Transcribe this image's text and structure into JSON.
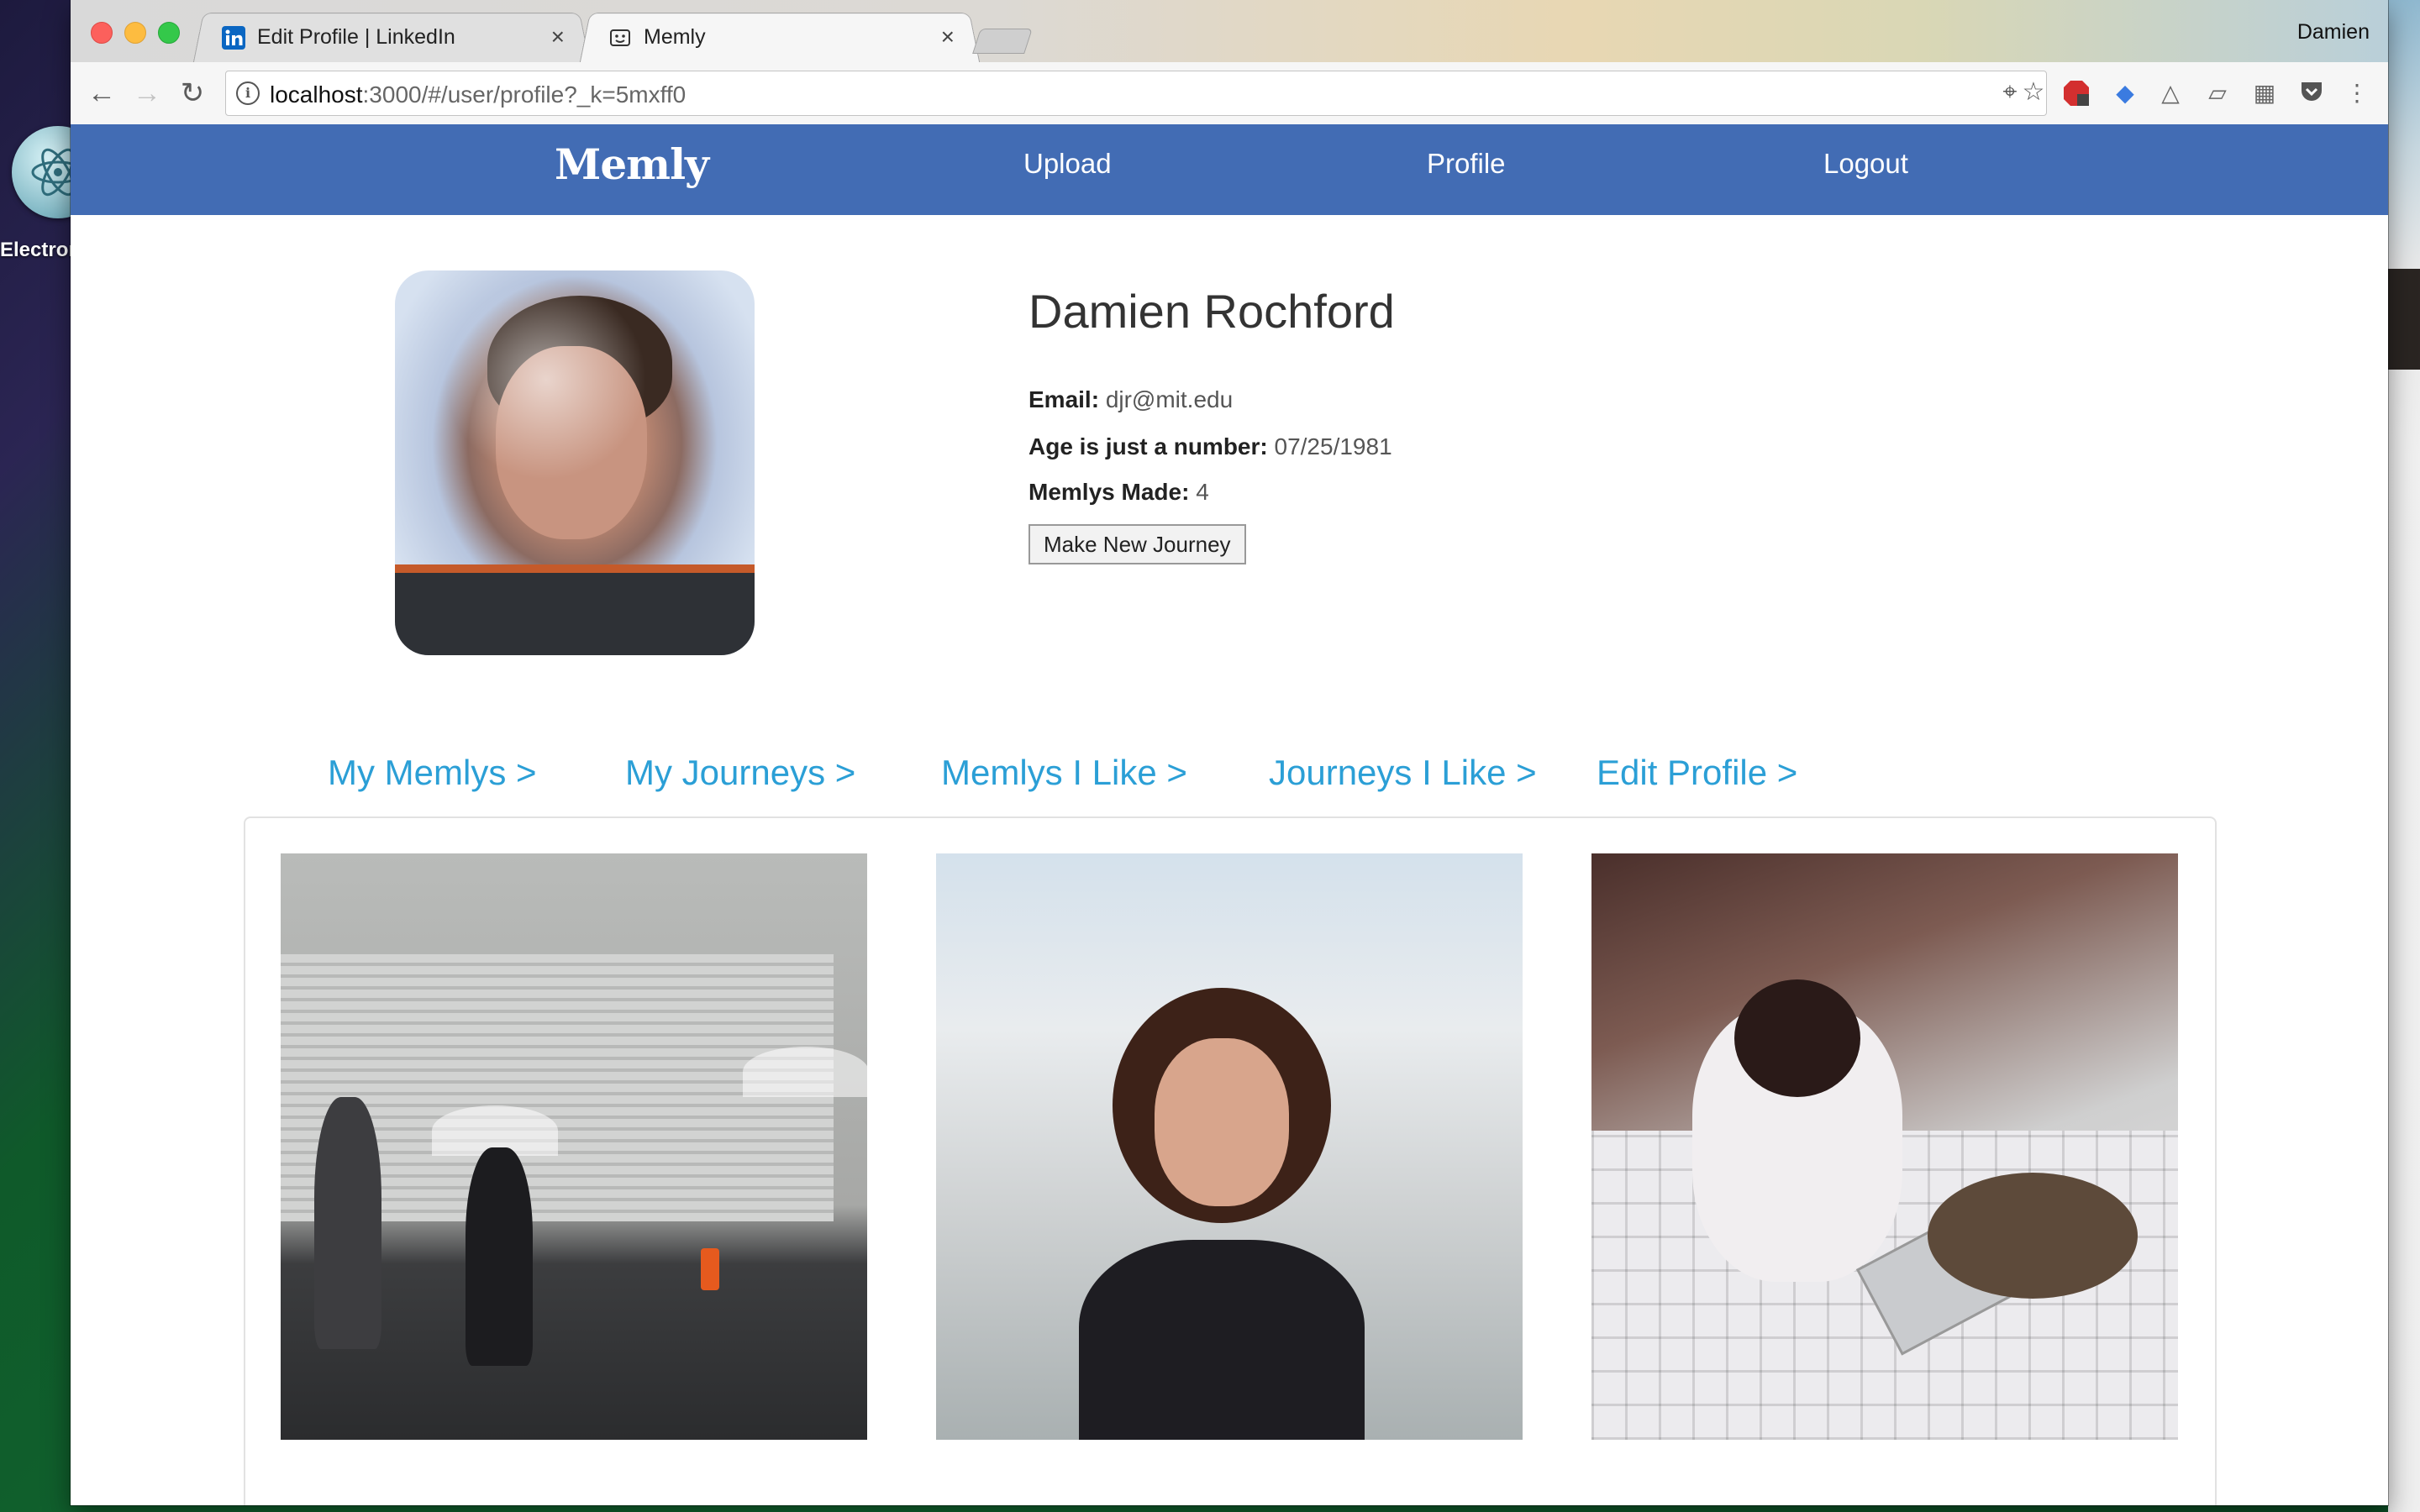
{
  "desktop": {
    "app_label": "Electron"
  },
  "browser": {
    "tabs": [
      {
        "title": "Edit Profile | LinkedIn",
        "close": "×"
      },
      {
        "title": "Memly",
        "close": "×"
      }
    ],
    "profile_name": "Damien",
    "url_host": "localhost",
    "url_rest": ":3000/#/user/profile?_k=5mxff0"
  },
  "navbar": {
    "brand": "Memly",
    "links": [
      "Upload",
      "Profile",
      "Logout"
    ]
  },
  "profile": {
    "name": "Damien Rochford",
    "email_label": "Email:",
    "email_value": "djr@mit.edu",
    "age_label": "Age is just a number:",
    "age_value": "07/25/1981",
    "made_label": "Memlys Made:",
    "made_value": "4",
    "new_journey_button": "Make New Journey"
  },
  "subnav": [
    "My Memlys >",
    "My Journeys >",
    "Memlys I Like >",
    "Journeys I Like >",
    "Edit Profile >"
  ],
  "gallery": {
    "tiles": [
      "street-umbrellas-photo",
      "waterfall-portrait-photo",
      "laptop-cat-photo"
    ]
  },
  "colors": {
    "navbar": "#426cb4",
    "link": "#2b9fd6"
  }
}
